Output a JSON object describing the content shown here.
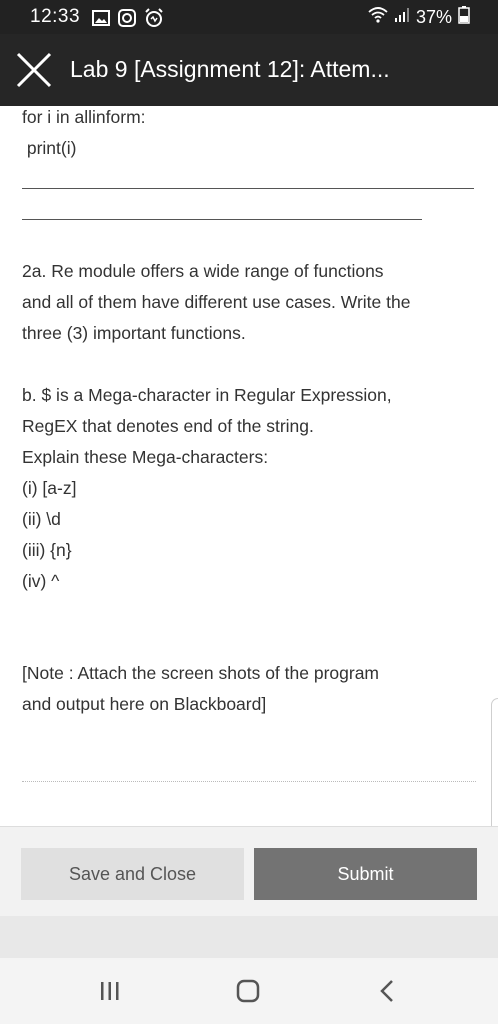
{
  "status_bar": {
    "time": "12:33",
    "battery": "37%",
    "icons_left": [
      "image-icon",
      "instagram-icon",
      "alarm-icon"
    ],
    "icons_right": [
      "wifi-icon",
      "signal-icon",
      "battery-icon"
    ]
  },
  "app_bar": {
    "title": "Lab 9 [Assignment 12]: Attem..."
  },
  "content": {
    "code_lines": [
      "for i in allinform:",
      " print(i)"
    ],
    "q2a_lines": [
      "2a. Re module offers a wide range of functions",
      "and all of them have different use cases. Write the",
      "three (3) important functions."
    ],
    "qb_lines": [
      "b. $ is a Mega-character in Regular Expression,",
      "RegEX that denotes end of the string.",
      "Explain these Mega-characters:",
      "(i) [a-z]",
      "(ii) \\d",
      "(iii) {n}",
      "(iv) ^"
    ],
    "note_lines": [
      "[Note : Attach the screen shots of the program",
      "and output here on Blackboard]"
    ]
  },
  "actions": {
    "save_label": "Save and Close",
    "submit_label": "Submit"
  },
  "nav_bar": {
    "buttons": [
      "recent-apps-icon",
      "home-icon",
      "back-icon"
    ]
  },
  "colors": {
    "status_bar_bg": "#222222",
    "app_bar_bg": "#262626",
    "submit_bg": "#737373",
    "save_bg": "#e0e0e0"
  }
}
